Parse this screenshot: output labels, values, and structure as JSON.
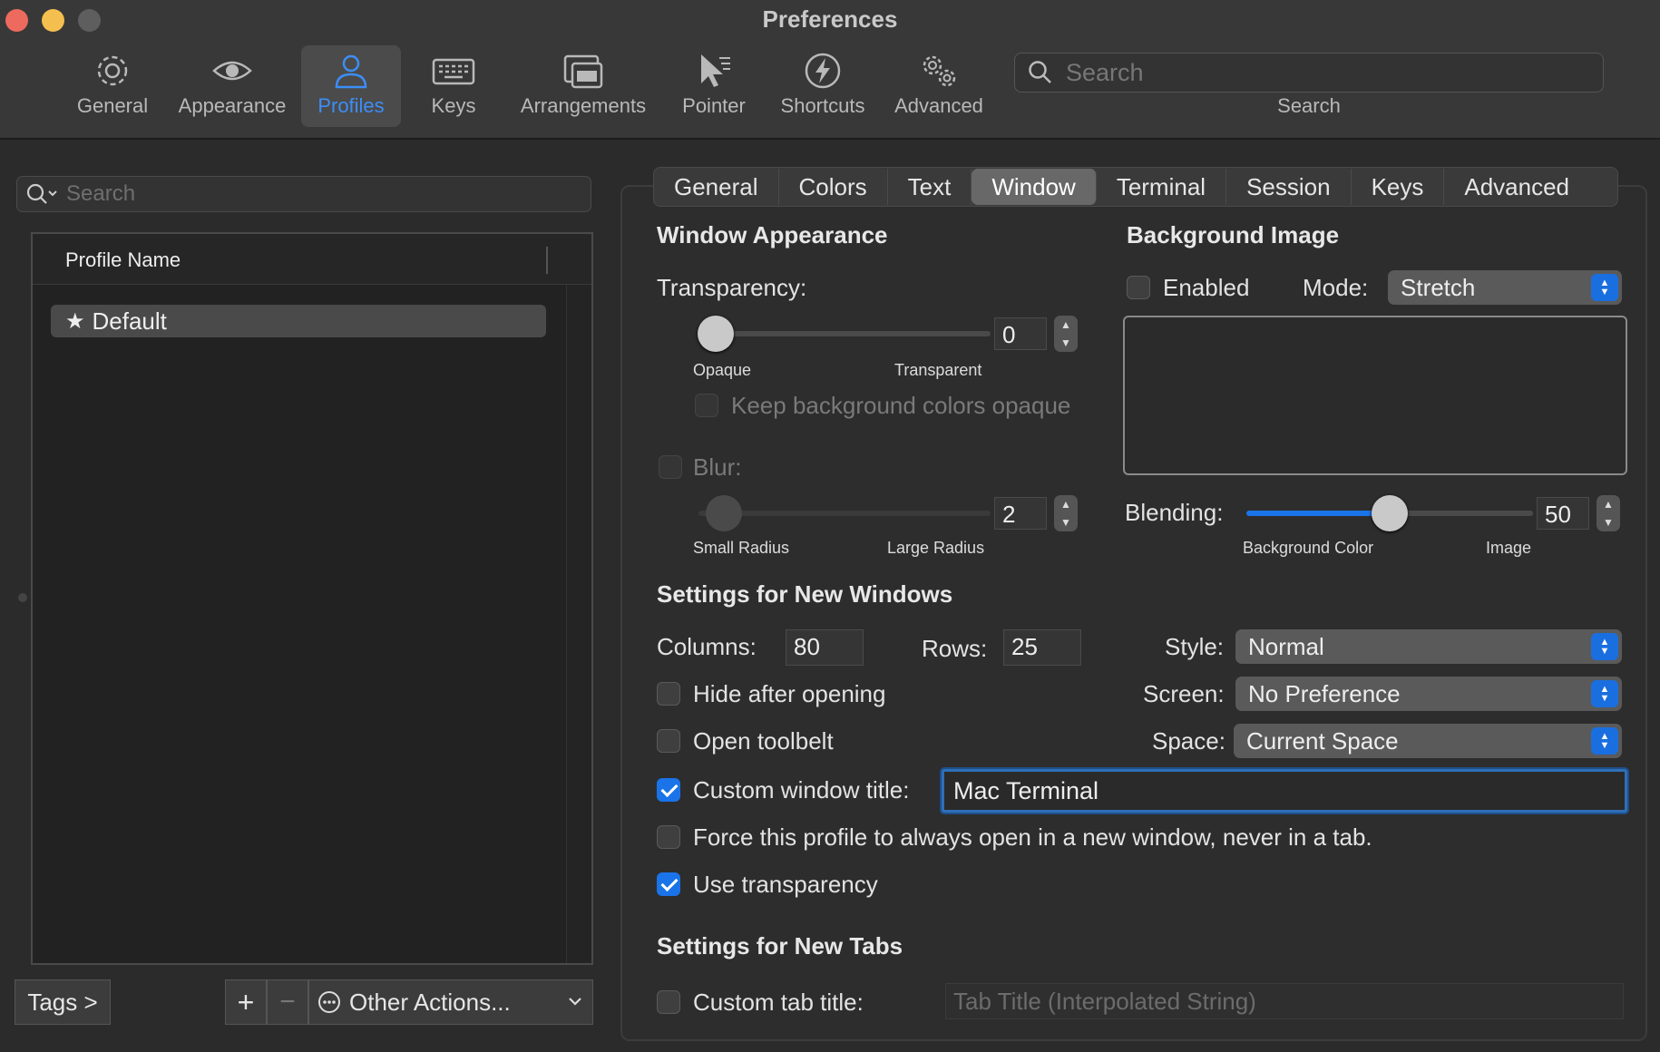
{
  "window": {
    "title": "Preferences"
  },
  "colors": {
    "accent": "#1a73e8",
    "active_toolbar_text": "#3c8ef7",
    "close": "#ed6a5e",
    "minimize": "#f5bf4f",
    "zoom": "#5e5e5e"
  },
  "toolbar": {
    "items": [
      {
        "label": "General",
        "icon": "gear-icon"
      },
      {
        "label": "Appearance",
        "icon": "eye-icon"
      },
      {
        "label": "Profiles",
        "icon": "person-icon",
        "active": true
      },
      {
        "label": "Keys",
        "icon": "keyboard-icon"
      },
      {
        "label": "Arrangements",
        "icon": "windows-icon"
      },
      {
        "label": "Pointer",
        "icon": "pointer-icon"
      },
      {
        "label": "Shortcuts",
        "icon": "bolt-icon"
      },
      {
        "label": "Advanced",
        "icon": "gears-icon"
      }
    ],
    "search": {
      "placeholder": "Search",
      "caption": "Search"
    }
  },
  "profiles": {
    "search_placeholder": "Search",
    "column_header": "Profile Name",
    "items": [
      {
        "name": "Default",
        "default": true
      }
    ],
    "tags_button": "Tags >",
    "add_button": "+",
    "remove_button": "−",
    "other_actions": "Other Actions..."
  },
  "tabs": [
    "General",
    "Colors",
    "Text",
    "Window",
    "Terminal",
    "Session",
    "Keys",
    "Advanced"
  ],
  "active_tab": "Window",
  "window_appearance": {
    "title": "Window Appearance",
    "transparency_label": "Transparency:",
    "transparency_value": "0",
    "transparency_min_label": "Opaque",
    "transparency_max_label": "Transparent",
    "keep_bg_opaque_label": "Keep background colors opaque",
    "keep_bg_opaque_checked": false,
    "blur_label": "Blur:",
    "blur_checked": false,
    "blur_value": "2",
    "blur_min_label": "Small Radius",
    "blur_max_label": "Large Radius"
  },
  "background_image": {
    "title": "Background Image",
    "enabled_label": "Enabled",
    "enabled_checked": false,
    "mode_label": "Mode:",
    "mode_value": "Stretch",
    "blending_label": "Blending:",
    "blending_value": "50",
    "blending_fraction": 0.5,
    "blending_min_label": "Background Color",
    "blending_max_label": "Image"
  },
  "new_windows": {
    "title": "Settings for New Windows",
    "columns_label": "Columns:",
    "columns_value": "80",
    "rows_label": "Rows:",
    "rows_value": "25",
    "style_label": "Style:",
    "style_value": "Normal",
    "screen_label": "Screen:",
    "screen_value": "No Preference",
    "space_label": "Space:",
    "space_value": "Current Space",
    "hide_after_opening_label": "Hide after opening",
    "hide_after_opening_checked": false,
    "open_toolbelt_label": "Open toolbelt",
    "open_toolbelt_checked": false,
    "custom_title_label": "Custom window title:",
    "custom_title_checked": true,
    "custom_title_value": "Mac Terminal",
    "force_new_window_label": "Force this profile to always open in a new window, never in a tab.",
    "force_new_window_checked": false,
    "use_transparency_label": "Use transparency",
    "use_transparency_checked": true
  },
  "new_tabs": {
    "title": "Settings for New Tabs",
    "custom_tab_title_label": "Custom tab title:",
    "custom_tab_title_checked": false,
    "custom_tab_title_placeholder": "Tab Title (Interpolated String)"
  }
}
